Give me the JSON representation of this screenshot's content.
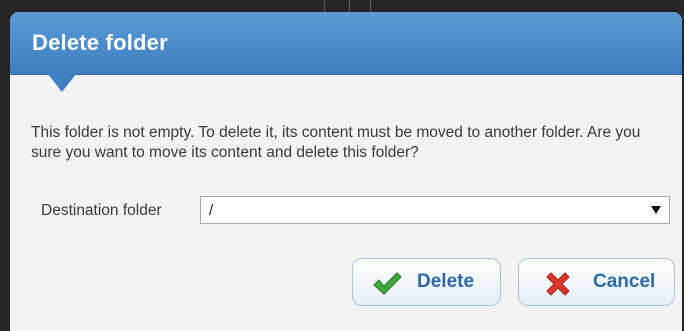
{
  "dialog": {
    "title": "Delete folder",
    "message": "This folder is not empty. To delete it, its content must be moved to another folder. Are you sure you want to move its content and delete this folder?",
    "destination_label": "Destination folder",
    "destination_value": "/",
    "delete_label": "Delete",
    "cancel_label": "Cancel"
  },
  "icons": {
    "delete": "check-icon",
    "cancel": "x-icon",
    "dropdown": "chevron-down-icon"
  },
  "colors": {
    "header": "#4a8acb",
    "button_text": "#2c6aa6",
    "check": "#3fa83a",
    "cancel_x": "#d9362b"
  }
}
